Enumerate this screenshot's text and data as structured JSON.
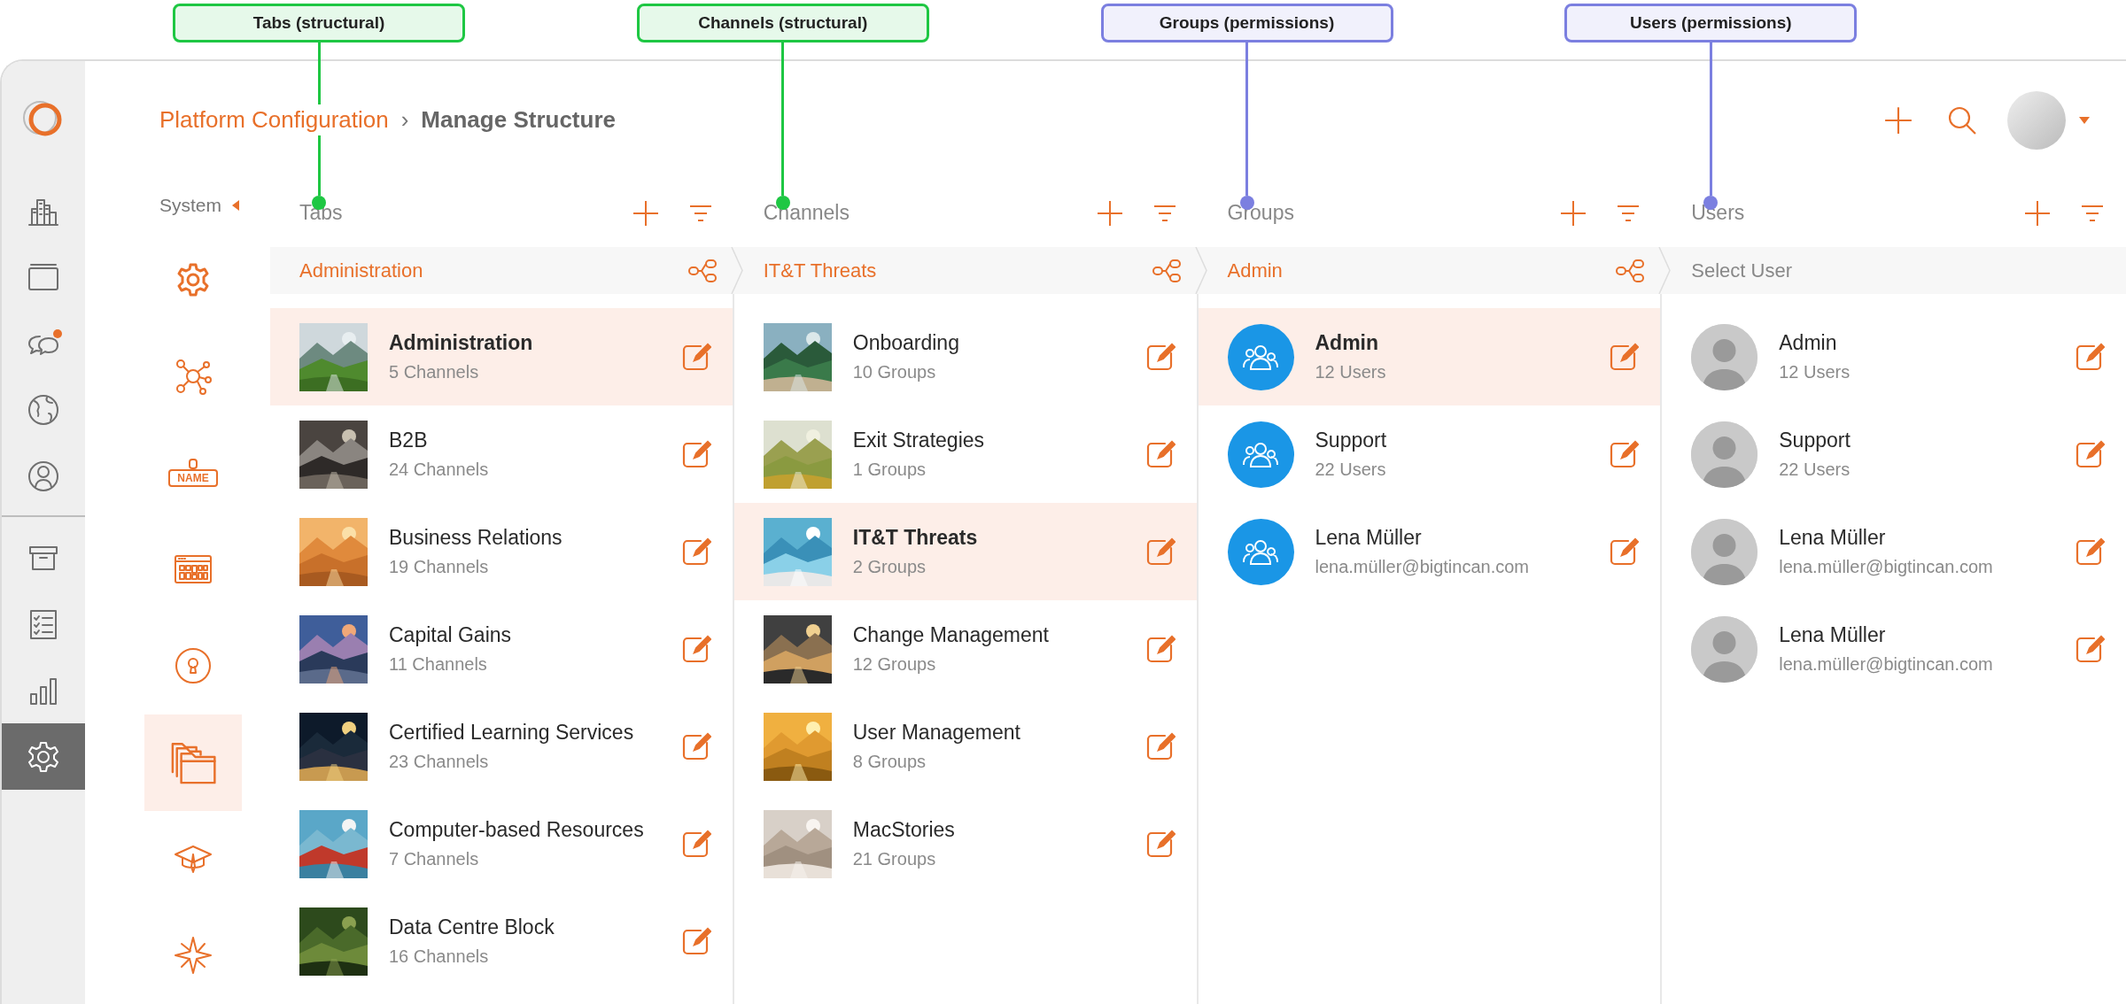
{
  "breadcrumb": {
    "parent": "Platform Configuration",
    "separator": "›",
    "current": "Manage Structure"
  },
  "rail": {
    "top": [
      {
        "selected": false,
        "badge": false
      },
      {
        "selected": false,
        "badge": false
      },
      {
        "selected": false,
        "badge": true
      },
      {
        "selected": false,
        "badge": false
      },
      {
        "selected": false,
        "badge": false
      }
    ],
    "bottom": [
      {
        "selected": false,
        "badge": false
      },
      {
        "selected": false,
        "badge": false
      },
      {
        "selected": false,
        "badge": false
      },
      {
        "selected": true,
        "badge": false
      }
    ]
  },
  "subnav": {
    "title": "System",
    "items": [
      {
        "selected": false
      },
      {
        "selected": false
      },
      {
        "label": "NAME",
        "selected": false
      },
      {
        "selected": false
      },
      {
        "selected": false
      },
      {
        "selected": true
      },
      {
        "selected": false
      },
      {
        "selected": false
      }
    ]
  },
  "columns": [
    {
      "title": "Tabs",
      "annotation": {
        "label": "Tabs (structural)",
        "color": "#1ec743"
      },
      "selection": "Administration",
      "rows": [
        {
          "kind": "picture",
          "name": "Administration",
          "detail": "5 Channels",
          "selected": true
        },
        {
          "kind": "picture",
          "name": "B2B",
          "detail": "24 Channels",
          "selected": false
        },
        {
          "kind": "picture",
          "name": "Business Relations",
          "detail": "19 Channels",
          "selected": false
        },
        {
          "kind": "picture",
          "name": "Capital Gains",
          "detail": "11 Channels",
          "selected": false
        },
        {
          "kind": "picture",
          "name": "Certified Learning Services",
          "detail": "23 Channels",
          "selected": false
        },
        {
          "kind": "picture",
          "name": "Computer-based Resources",
          "detail": "7 Channels",
          "selected": false
        },
        {
          "kind": "picture",
          "name": "Data Centre Block",
          "detail": "16 Channels",
          "selected": false
        }
      ]
    },
    {
      "title": "Channels",
      "annotation": {
        "label": "Channels (structural)",
        "color": "#1ec743"
      },
      "selection": "IT&T Threats",
      "rows": [
        {
          "kind": "picture",
          "name": "Onboarding",
          "detail": "10 Groups",
          "selected": false
        },
        {
          "kind": "picture",
          "name": "Exit Strategies",
          "detail": "1 Groups",
          "selected": false
        },
        {
          "kind": "picture",
          "name": "IT&T Threats",
          "detail": "2 Groups",
          "selected": true
        },
        {
          "kind": "picture",
          "name": "Change Management",
          "detail": "12 Groups",
          "selected": false
        },
        {
          "kind": "picture",
          "name": "User Management",
          "detail": "8 Groups",
          "selected": false
        },
        {
          "kind": "picture",
          "name": "MacStories",
          "detail": "21 Groups",
          "selected": false
        }
      ]
    },
    {
      "title": "Groups",
      "annotation": {
        "label": "Groups (permissions)",
        "color": "#7b7fe0"
      },
      "selection": "Admin",
      "rows": [
        {
          "kind": "group",
          "name": "Admin",
          "detail": "12 Users",
          "selected": true
        },
        {
          "kind": "group",
          "name": "Support",
          "detail": "22 Users",
          "selected": false
        },
        {
          "kind": "group",
          "name": "Lena Müller",
          "detail": "lena.müller@bigtincan.com",
          "selected": false
        }
      ]
    },
    {
      "title": "Users",
      "annotation": {
        "label": "Users (permissions)",
        "color": "#7b7fe0"
      },
      "placeholder": "Select User",
      "rows": [
        {
          "kind": "user",
          "name": "Admin",
          "detail": "12 Users",
          "selected": false
        },
        {
          "kind": "user",
          "name": "Support",
          "detail": "22 Users",
          "selected": false
        },
        {
          "kind": "user",
          "name": "Lena Müller",
          "detail": "lena.müller@bigtincan.com",
          "selected": false
        },
        {
          "kind": "user",
          "name": "Lena Müller",
          "detail": "lena.müller@bigtincan.com",
          "selected": false
        }
      ]
    }
  ]
}
